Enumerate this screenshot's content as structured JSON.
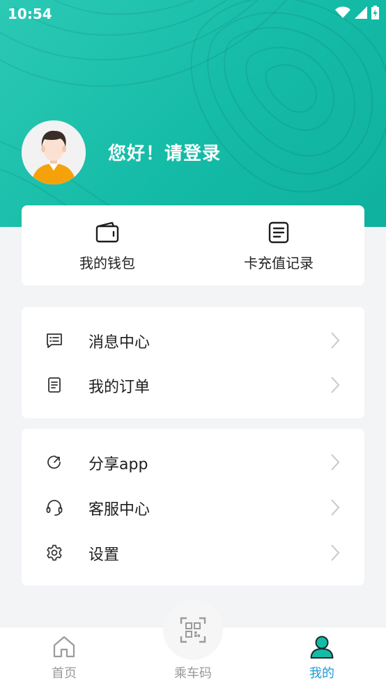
{
  "status_bar": {
    "time": "10:54"
  },
  "profile": {
    "greeting": "您好！请登录"
  },
  "quick_actions": [
    {
      "label": "我的钱包",
      "icon": "wallet-icon"
    },
    {
      "label": "卡充值记录",
      "icon": "document-icon"
    }
  ],
  "menu_group_1": [
    {
      "label": "消息中心",
      "icon": "message-icon"
    },
    {
      "label": "我的订单",
      "icon": "order-icon"
    }
  ],
  "menu_group_2": [
    {
      "label": "分享app",
      "icon": "share-icon"
    },
    {
      "label": "客服中心",
      "icon": "headset-icon"
    },
    {
      "label": "设置",
      "icon": "gear-icon"
    }
  ],
  "bottom_nav": [
    {
      "label": "首页",
      "icon": "home-icon",
      "active": false
    },
    {
      "label": "乘车码",
      "icon": "qr-code-icon",
      "active": false
    },
    {
      "label": "我的",
      "icon": "user-icon",
      "active": true
    }
  ],
  "colors": {
    "accent": "#14bba6",
    "active_tab": "#1a9bd8",
    "background": "#f3f4f6"
  }
}
